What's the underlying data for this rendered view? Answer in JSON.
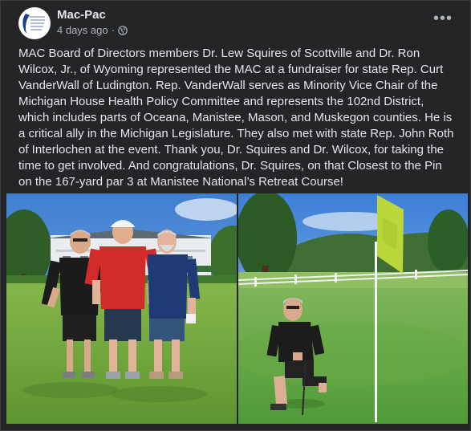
{
  "post": {
    "author": "Mac-Pac",
    "time": "4 days ago",
    "separator": "·",
    "more_label": "•••",
    "text": "MAC Board of Directors members Dr. Lew Squires of Scottville and Dr. Ron Wilcox, Jr., of Wyoming represented the MAC at a fundraiser for state Rep. Curt VanderWall of Ludington. Rep. VanderWall serves as Minority Vice Chair of the Michigan House Health Policy Committee and represents the 102nd District, which includes parts of Oceana, Manistee, Mason, and Muskegon counties. He is a critical ally in the Michigan Legislature. They also met with state Rep. John Roth of Interlochen at the event. Thank you, Dr. Squires and Dr. Wilcox, for taking the time to get involved. And congratulations, Dr. Squires, on that Closest to the Pin on the 167-yard par 3 at Manistee National’s Retreat Course!"
  },
  "icons": {
    "avatar": "mac-pac-logo",
    "privacy": "globe-icon",
    "more": "more-options-icon"
  },
  "colors": {
    "card_bg": "#242526",
    "text": "#e4e6eb",
    "secondary_text": "#b0b3b8",
    "flag": "#b9d63a"
  }
}
